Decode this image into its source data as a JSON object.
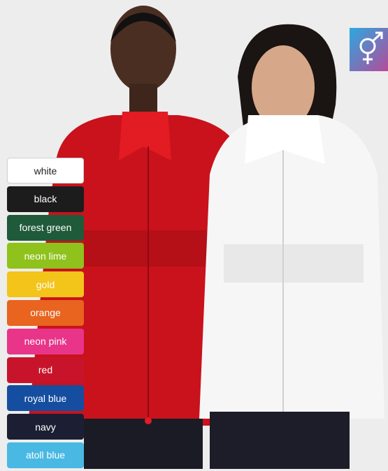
{
  "swatches": [
    {
      "label": "white",
      "color": "#ffffff"
    },
    {
      "label": "black",
      "color": "#1c1c1c"
    },
    {
      "label": "forest green",
      "color": "#1f5a3a"
    },
    {
      "label": "neon lime",
      "color": "#8fc21c"
    },
    {
      "label": "gold",
      "color": "#f3c41a"
    },
    {
      "label": "orange",
      "color": "#e8641f"
    },
    {
      "label": "neon pink",
      "color": "#e8358a"
    },
    {
      "label": "red",
      "color": "#c8142b"
    },
    {
      "label": "royal blue",
      "color": "#154ea0"
    },
    {
      "label": "navy",
      "color": "#1c1f33"
    },
    {
      "label": "atoll blue",
      "color": "#49b8e2"
    }
  ],
  "badge": {
    "icon": "unisex-icon",
    "gradient_from": "#2aa9e0",
    "gradient_to": "#b54a9a"
  }
}
